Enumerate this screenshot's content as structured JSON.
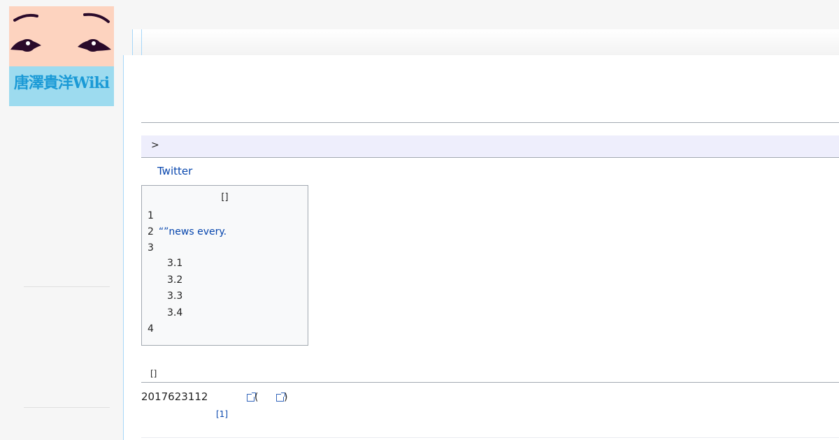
{
  "site": {
    "logo_text": "唐澤貴洋Wiki",
    "colors": {
      "face": "#fdd3bf",
      "band": "#9ddbef",
      "text": "#1b9ad6",
      "link": "#0645ad"
    }
  },
  "breadcrumb": {
    "arrow": ">"
  },
  "links": {
    "twitter": "Twitter"
  },
  "toc": {
    "title": "[]",
    "items": [
      {
        "num": "1",
        "text": ""
      },
      {
        "num": "2",
        "text": "“”news every."
      },
      {
        "num": "3",
        "text": ""
      },
      {
        "num": "3.1",
        "text": ""
      },
      {
        "num": "3.2",
        "text": ""
      },
      {
        "num": "3.3",
        "text": ""
      },
      {
        "num": "3.4",
        "text": ""
      },
      {
        "num": "4",
        "text": ""
      }
    ]
  },
  "section": {
    "edit_marker": "[]",
    "date_text": "2017623112",
    "paren_open": "(",
    "paren_close": ")",
    "ref": "[1]"
  }
}
